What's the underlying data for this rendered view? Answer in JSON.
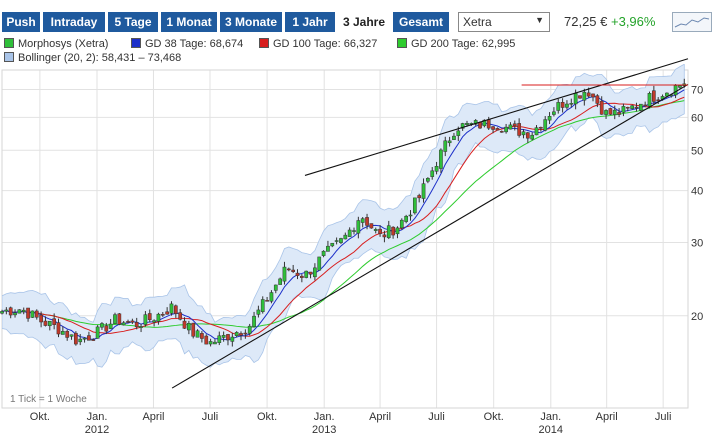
{
  "toolbar": {
    "periods": [
      {
        "label": "Push",
        "active": false
      },
      {
        "label": "Intraday",
        "active": false
      },
      {
        "label": "5 Tage",
        "active": false
      },
      {
        "label": "1 Monat",
        "active": false
      },
      {
        "label": "3 Monate",
        "active": false
      },
      {
        "label": "1 Jahr",
        "active": false
      },
      {
        "label": "3 Jahre",
        "active": true
      },
      {
        "label": "Gesamt",
        "active": false
      }
    ],
    "exchange": "Xetra",
    "price": "72,25 €",
    "change": "+3,96%",
    "change_color": "#24a32a",
    "button_color": "#1f5a9e"
  },
  "legend": {
    "items": [
      {
        "label": "Morphosys (Xetra)",
        "color": "#2fbf3a"
      },
      {
        "label": "GD 38 Tage: 68,674",
        "color": "#1c2fc9"
      },
      {
        "label": "GD 100 Tage: 66,327",
        "color": "#d81e1e"
      },
      {
        "label": "GD 200 Tage: 62,995",
        "color": "#2ecc2e"
      },
      {
        "label": "Bollinger (20, 2): 58,431 – 73,468",
        "color": "#a9c4e8"
      }
    ]
  },
  "footnote": "1 Tick = 1 Woche",
  "chart_data": {
    "type": "candlestick",
    "y_scale": "log",
    "ylim": [
      12,
      78
    ],
    "y_ticks": [
      20,
      30,
      40,
      50,
      60,
      70
    ],
    "x_range": [
      "2011-08-01",
      "2014-08-10"
    ],
    "x_month_ticks": [
      {
        "label": "Okt.",
        "date": "2011-10-01"
      },
      {
        "label": "Jan.",
        "date": "2012-01-01"
      },
      {
        "label": "April",
        "date": "2012-04-01"
      },
      {
        "label": "Juli",
        "date": "2012-07-01"
      },
      {
        "label": "Okt.",
        "date": "2012-10-01"
      },
      {
        "label": "Jan.",
        "date": "2013-01-01"
      },
      {
        "label": "April",
        "date": "2013-04-01"
      },
      {
        "label": "Juli",
        "date": "2013-07-01"
      },
      {
        "label": "Okt.",
        "date": "2013-10-01"
      },
      {
        "label": "Jan.",
        "date": "2014-01-01"
      },
      {
        "label": "April",
        "date": "2014-04-01"
      },
      {
        "label": "Juli",
        "date": "2014-07-01"
      }
    ],
    "x_year_labels": [
      {
        "label": "2012",
        "date": "2012-01-01"
      },
      {
        "label": "2013",
        "date": "2013-01-01"
      },
      {
        "label": "2014",
        "date": "2014-01-01"
      }
    ],
    "grid": true,
    "price_path": [
      [
        "2011-08-01",
        20.5
      ],
      [
        "2011-09-01",
        20.8
      ],
      [
        "2011-10-01",
        19.5
      ],
      [
        "2011-11-01",
        18.6
      ],
      [
        "2011-12-01",
        17.4
      ],
      [
        "2012-01-01",
        18.2
      ],
      [
        "2012-02-01",
        19.6
      ],
      [
        "2012-03-01",
        19.0
      ],
      [
        "2012-04-01",
        19.8
      ],
      [
        "2012-05-01",
        21.0
      ],
      [
        "2012-06-01",
        18.3
      ],
      [
        "2012-07-01",
        17.2
      ],
      [
        "2012-08-01",
        18.0
      ],
      [
        "2012-09-01",
        18.8
      ],
      [
        "2012-10-01",
        22.0
      ],
      [
        "2012-11-01",
        26.0
      ],
      [
        "2012-12-01",
        25.0
      ],
      [
        "2013-01-01",
        28.0
      ],
      [
        "2013-02-01",
        30.5
      ],
      [
        "2013-03-01",
        35.0
      ],
      [
        "2013-04-01",
        31.0
      ],
      [
        "2013-05-01",
        33.0
      ],
      [
        "2013-06-01",
        38.0
      ],
      [
        "2013-07-01",
        47.0
      ],
      [
        "2013-08-01",
        57.0
      ],
      [
        "2013-09-01",
        57.5
      ],
      [
        "2013-10-01",
        58.0
      ],
      [
        "2013-11-01",
        56.0
      ],
      [
        "2013-12-01",
        55.0
      ],
      [
        "2014-01-01",
        62.0
      ],
      [
        "2014-02-01",
        67.0
      ],
      [
        "2014-03-01",
        70.0
      ],
      [
        "2014-04-01",
        61.0
      ],
      [
        "2014-05-01",
        62.0
      ],
      [
        "2014-06-01",
        66.0
      ],
      [
        "2014-07-01",
        69.0
      ],
      [
        "2014-08-01",
        72.25
      ]
    ],
    "lines": {
      "gd38_end": 68.674,
      "gd100_end": 66.327,
      "gd200_end": 62.995,
      "bollinger_low": 58.431,
      "bollinger_high": 73.468
    },
    "trendlines": [
      {
        "from": [
          "2012-05-01",
          13.4
        ],
        "to": [
          "2014-08-10",
          72.0
        ]
      },
      {
        "from": [
          "2012-12-01",
          43.5
        ],
        "to": [
          "2014-08-10",
          83.0
        ]
      }
    ],
    "resistance": {
      "value": 71.8,
      "from": "2013-11-15",
      "to": "2014-08-10"
    }
  }
}
